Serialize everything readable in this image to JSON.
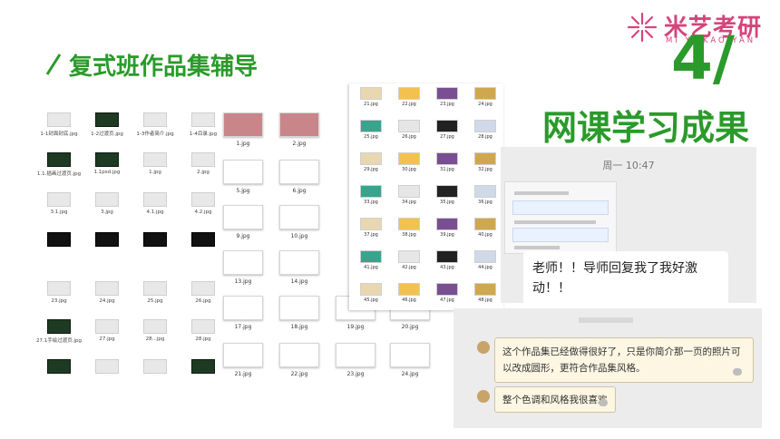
{
  "logo": {
    "text": "米艺考研",
    "sub": "MI YI KAO YAN",
    "color": "#d5457c"
  },
  "header": {
    "title": "复式班作品集辅导",
    "number": "4/",
    "subtitle": "网课学习成果"
  },
  "accent": "#2a9a2a",
  "grid1": [
    {
      "label": "1-1封面封底.jpg",
      "tone": "light"
    },
    {
      "label": "1-2过渡页.jpg",
      "tone": "dark"
    },
    {
      "label": "1-3作者简介.jpg",
      "tone": "light"
    },
    {
      "label": "1-4目录.jpg",
      "tone": "light"
    },
    {
      "label": "1.1.插画过渡页.jpg",
      "tone": "dark"
    },
    {
      "label": "1.1psd.jpg",
      "tone": "dark"
    },
    {
      "label": "1.jpg",
      "tone": "light"
    },
    {
      "label": "2.jpg",
      "tone": "light"
    },
    {
      "label": "3.1.jpg",
      "tone": "light"
    },
    {
      "label": "3.jpg",
      "tone": "light"
    },
    {
      "label": "4.1.jpg",
      "tone": "light"
    },
    {
      "label": "4.2.jpg",
      "tone": "light"
    },
    {
      "label": "",
      "tone": "black"
    },
    {
      "label": "",
      "tone": "black"
    },
    {
      "label": "",
      "tone": "black"
    },
    {
      "label": "",
      "tone": "black"
    },
    {
      "label": "23.jpg",
      "tone": "light"
    },
    {
      "label": "24.jpg",
      "tone": "light"
    },
    {
      "label": "25.jpg",
      "tone": "light"
    },
    {
      "label": "26.jpg",
      "tone": "light"
    },
    {
      "label": "27.1手绘过渡页.jpg",
      "tone": "dark"
    },
    {
      "label": "27.jpg",
      "tone": "light"
    },
    {
      "label": "28...jpg",
      "tone": "light"
    },
    {
      "label": "28.jpg",
      "tone": "light"
    },
    {
      "label": "",
      "tone": "dark"
    },
    {
      "label": "",
      "tone": "light"
    },
    {
      "label": "",
      "tone": "light"
    },
    {
      "label": "",
      "tone": "dark"
    }
  ],
  "grid2": [
    {
      "label": "1.jpg",
      "fill": "#c9868a"
    },
    {
      "label": "2.jpg",
      "fill": "#c9868a"
    },
    {
      "label": "5.jpg",
      "fill": "#fff"
    },
    {
      "label": "6.jpg",
      "fill": "#fff"
    },
    {
      "label": "9.jpg",
      "fill": "#fff"
    },
    {
      "label": "10.jpg",
      "fill": "#fff"
    },
    {
      "label": "13.jpg",
      "fill": "#fff"
    },
    {
      "label": "14.jpg",
      "fill": "#fff"
    },
    {
      "label": "17.jpg",
      "fill": "#fff"
    },
    {
      "label": "18.jpg",
      "fill": "#fff"
    },
    {
      "label": "19.jpg",
      "fill": "#fff"
    },
    {
      "label": "20.jpg",
      "fill": "#fff"
    },
    {
      "label": "21.jpg",
      "fill": "#fff"
    },
    {
      "label": "22.jpg",
      "fill": "#fff"
    },
    {
      "label": "23.jpg",
      "fill": "#fff"
    },
    {
      "label": "24.jpg",
      "fill": "#fff"
    }
  ],
  "grid3": [
    "21.jpg",
    "22.jpg",
    "23.jpg",
    "24.jpg",
    "25.jpg",
    "26.jpg",
    "27.jpg",
    "28.jpg",
    "29.jpg",
    "30.jpg",
    "31.jpg",
    "32.jpg",
    "33.jpg",
    "34.jpg",
    "35.jpg",
    "36.jpg",
    "37.jpg",
    "38.jpg",
    "39.jpg",
    "40.jpg",
    "41.jpg",
    "42.jpg",
    "43.jpg",
    "44.jpg",
    "45.jpg",
    "46.jpg",
    "47.jpg",
    "48.jpg"
  ],
  "chat": {
    "time": "周一 10:47",
    "message": "老师！！导师回复我了我好激动！！"
  },
  "chat2": {
    "msg1": "这个作品集已经做得很好了，只是你简介那一页的照片可以改成圆形，更符合作品集风格。",
    "msg2": "整个色调和风格我很喜欢"
  }
}
